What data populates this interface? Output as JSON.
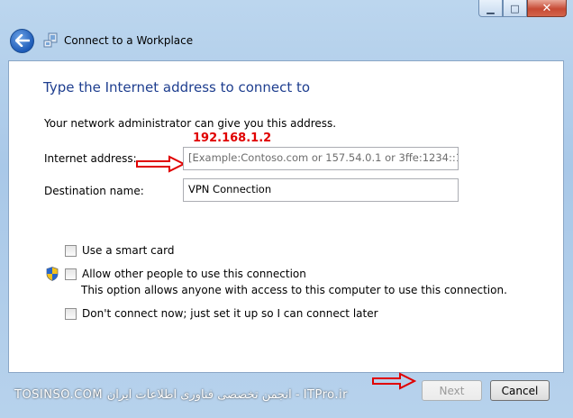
{
  "window": {
    "controls": {
      "minimize": "▁",
      "maximize": "□",
      "close": "✕"
    }
  },
  "nav": {
    "title": "Connect to a Workplace",
    "back_icon": "back-arrow-icon",
    "app_icon": "network-icon"
  },
  "page": {
    "heading": "Type the Internet address to connect to",
    "description": "Your network administrator can give you this address.",
    "annotation_ip": "192.168.1.2",
    "annotation_color": "#e00000"
  },
  "form": {
    "internet_address": {
      "label": "Internet address:",
      "value": "",
      "placeholder": "[Example:Contoso.com or 157.54.0.1 or 3ffe:1234::1111]"
    },
    "destination_name": {
      "label": "Destination name:",
      "value": "VPN Connection"
    },
    "options": [
      {
        "label": "Use a smart card",
        "checked": false
      },
      {
        "label": "Allow other people to use this connection",
        "checked": false,
        "note": "This option allows anyone with access to this computer to use this connection."
      },
      {
        "label": "Don't connect now; just set it up so I can connect later",
        "checked": false
      }
    ]
  },
  "footer": {
    "watermark": "TOSINSO.COM  انجمن تخصصی فناوری اطلاعات ایران - ITPro.ir",
    "next_label": "Next",
    "cancel_label": "Cancel"
  },
  "colors": {
    "heading": "#1e3e8f",
    "frame": "#b7d2ec",
    "annotation_arrow": "#e00000"
  }
}
